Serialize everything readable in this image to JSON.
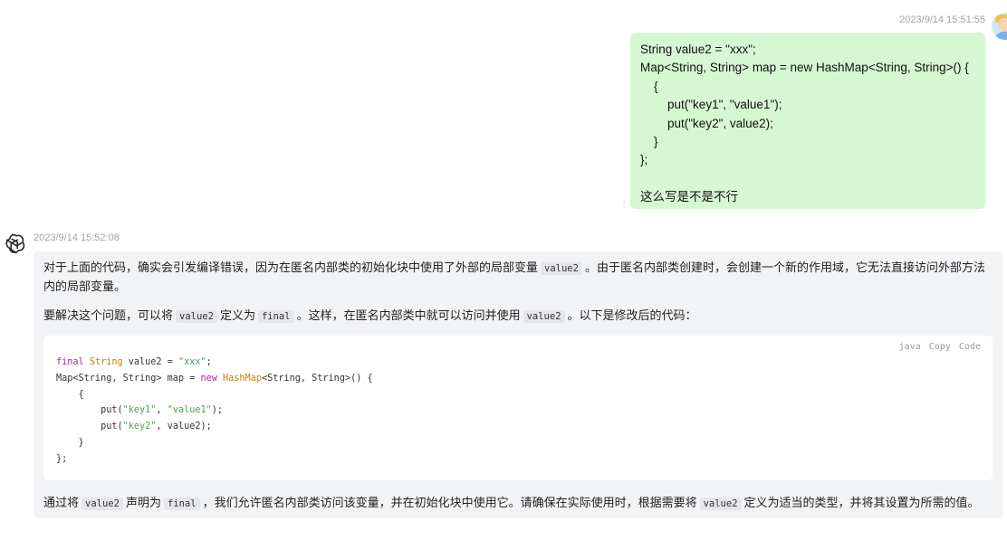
{
  "user_message": {
    "timestamp": "2023/9/14 15:51:55",
    "lines": [
      "String value2 = \"xxx\";",
      "Map<String, String> map = new HashMap<String, String>() {",
      "    {",
      "        put(\"key1\", \"value1\");",
      "        put(\"key2\", value2);",
      "    }",
      "};",
      "",
      "这么写是不是不行"
    ]
  },
  "assistant_message": {
    "timestamp": "2023/9/14 15:52:08",
    "para1": {
      "a": "对于上面的代码，确实会引发编译错误，因为在匿名内部类的初始化块中使用了外部的局部变量",
      "code": "value2",
      "b": "。由于匿名内部类创建时，会创建一个新的作用域，它无法直接访问外部方法内的局部变量。"
    },
    "para2": {
      "a": "要解决这个问题，可以将",
      "code1": "value2",
      "b": "定义为",
      "code2": "final",
      "c": "。这样，在匿名内部类中就可以访问并使用",
      "code3": "value2",
      "d": "。以下是修改后的代码："
    },
    "code_block": {
      "language": "java",
      "copy_label": "Copy",
      "code_label": "Code",
      "lines": [
        {
          "kw": "final",
          "ty": "String",
          "rest": " value2 = ",
          "str": "\"xxx\"",
          "end": ";"
        },
        {
          "pre": "Map<String, String> map = ",
          "kw": "new",
          "ty": "HashMap",
          "rest": "<String, String>() {"
        },
        {
          "plain": "    {"
        },
        {
          "pre": "        put(",
          "s1": "\"key1\"",
          "mid": ", ",
          "s2": "\"value1\"",
          "end": ");"
        },
        {
          "pre": "        put(",
          "s1": "\"key2\"",
          "mid": ", value2);"
        },
        {
          "plain": "    }"
        },
        {
          "plain": "};"
        }
      ]
    },
    "para3": {
      "a": "通过将",
      "code1": "value2",
      "b": "声明为",
      "code2": "final",
      "c": "，我们允许匿名内部类访问该变量，并在初始化块中使用它。请确保在实际使用时，根据需要将",
      "code3": "value2",
      "d": "定义为适当的类型，并将其设置为所需的值。"
    }
  },
  "icons": {
    "avatar": "user-avatar",
    "assistant": "chatgpt-logo-icon",
    "menu": "more-vertical-icon"
  },
  "colors": {
    "user_bubble": "#d5f7d2",
    "assistant_bubble": "#f2f3f5",
    "code_keyword": "#a626a4",
    "code_type": "#c18401",
    "code_string": "#50a14f"
  }
}
